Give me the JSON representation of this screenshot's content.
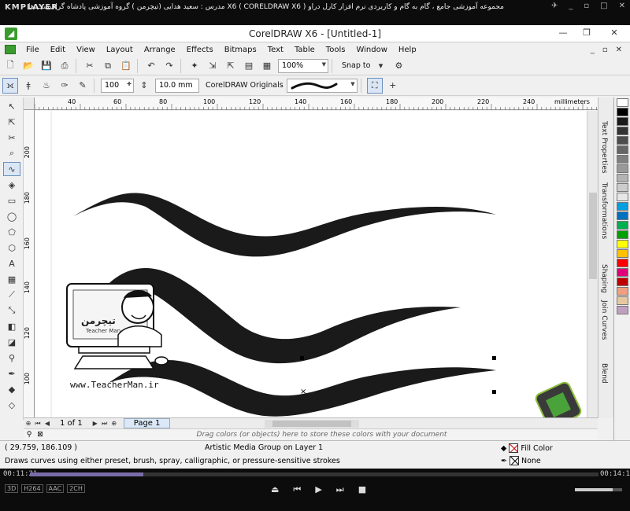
{
  "player": {
    "logo": "KMPLAYER",
    "title": "مجموعه آموزشی جامع ، گام به گام و کاربردی نرم افزار کارل دراو X6 ( CORELDRAW X6 )  مدرس : سعید هدایی (تیچرمن ) گروه آموزشی پادشاه گرافیست ها",
    "time_elapsed": "00:11:21",
    "time_total": "00:14:11",
    "progress_fraction": 0.2,
    "volume_fraction": 0.8,
    "badges": [
      "3D",
      "H264",
      "AAC",
      "2CH"
    ]
  },
  "window": {
    "title": "CorelDRAW X6 - [Untitled-1]"
  },
  "menu": [
    "File",
    "Edit",
    "View",
    "Layout",
    "Arrange",
    "Effects",
    "Bitmaps",
    "Text",
    "Table",
    "Tools",
    "Window",
    "Help"
  ],
  "toolbar": {
    "zoom": "100%",
    "snap_to": "Snap to"
  },
  "propbar": {
    "stroke_width_pct": "100",
    "width_value": "10.0 mm",
    "preset_list": "CorelDRAW Originals"
  },
  "ruler": {
    "h_ticks": [
      "40",
      "60",
      "80",
      "100",
      "120",
      "140",
      "160",
      "180",
      "200",
      "220",
      "240"
    ],
    "v_ticks": [
      "200",
      "180",
      "160",
      "140",
      "120",
      "100"
    ],
    "unit": "millimeters"
  },
  "navigation": {
    "page_of": "1 of 1",
    "page_tab": "Page 1"
  },
  "color_dock_hint": "Drag colors (or objects) here to store these colors with your document",
  "status": {
    "coords": "( 29.759, 186.109 )",
    "layer_info": "Artistic Media Group on Layer 1",
    "hint": "Draws curves using either preset, brush, spray, calligraphic, or pressure-sensitive strokes",
    "fill_label": "Fill Color",
    "outline_label": "None"
  },
  "docker_tabs": [
    "Text Properties",
    "Transformations",
    "Shaping",
    "Join Curves",
    "Blend"
  ],
  "palette": [
    "#ffffff",
    "#000000",
    "#1a1a1a",
    "#333333",
    "#4d4d4d",
    "#666666",
    "#808080",
    "#999999",
    "#b3b3b3",
    "#cccccc",
    "#e6e6e6",
    "#00a0e0",
    "#0070c0",
    "#00b050",
    "#00a000",
    "#ffff00",
    "#ffc000",
    "#ff0000",
    "#e0007a",
    "#c00000",
    "#f0a080",
    "#e6c8a0",
    "#c0a0c0"
  ],
  "watermark": {
    "logo_text_fa": "تیچرمن",
    "logo_text_en": "Teacher Man",
    "url": "www.TeacherMan.ir"
  }
}
